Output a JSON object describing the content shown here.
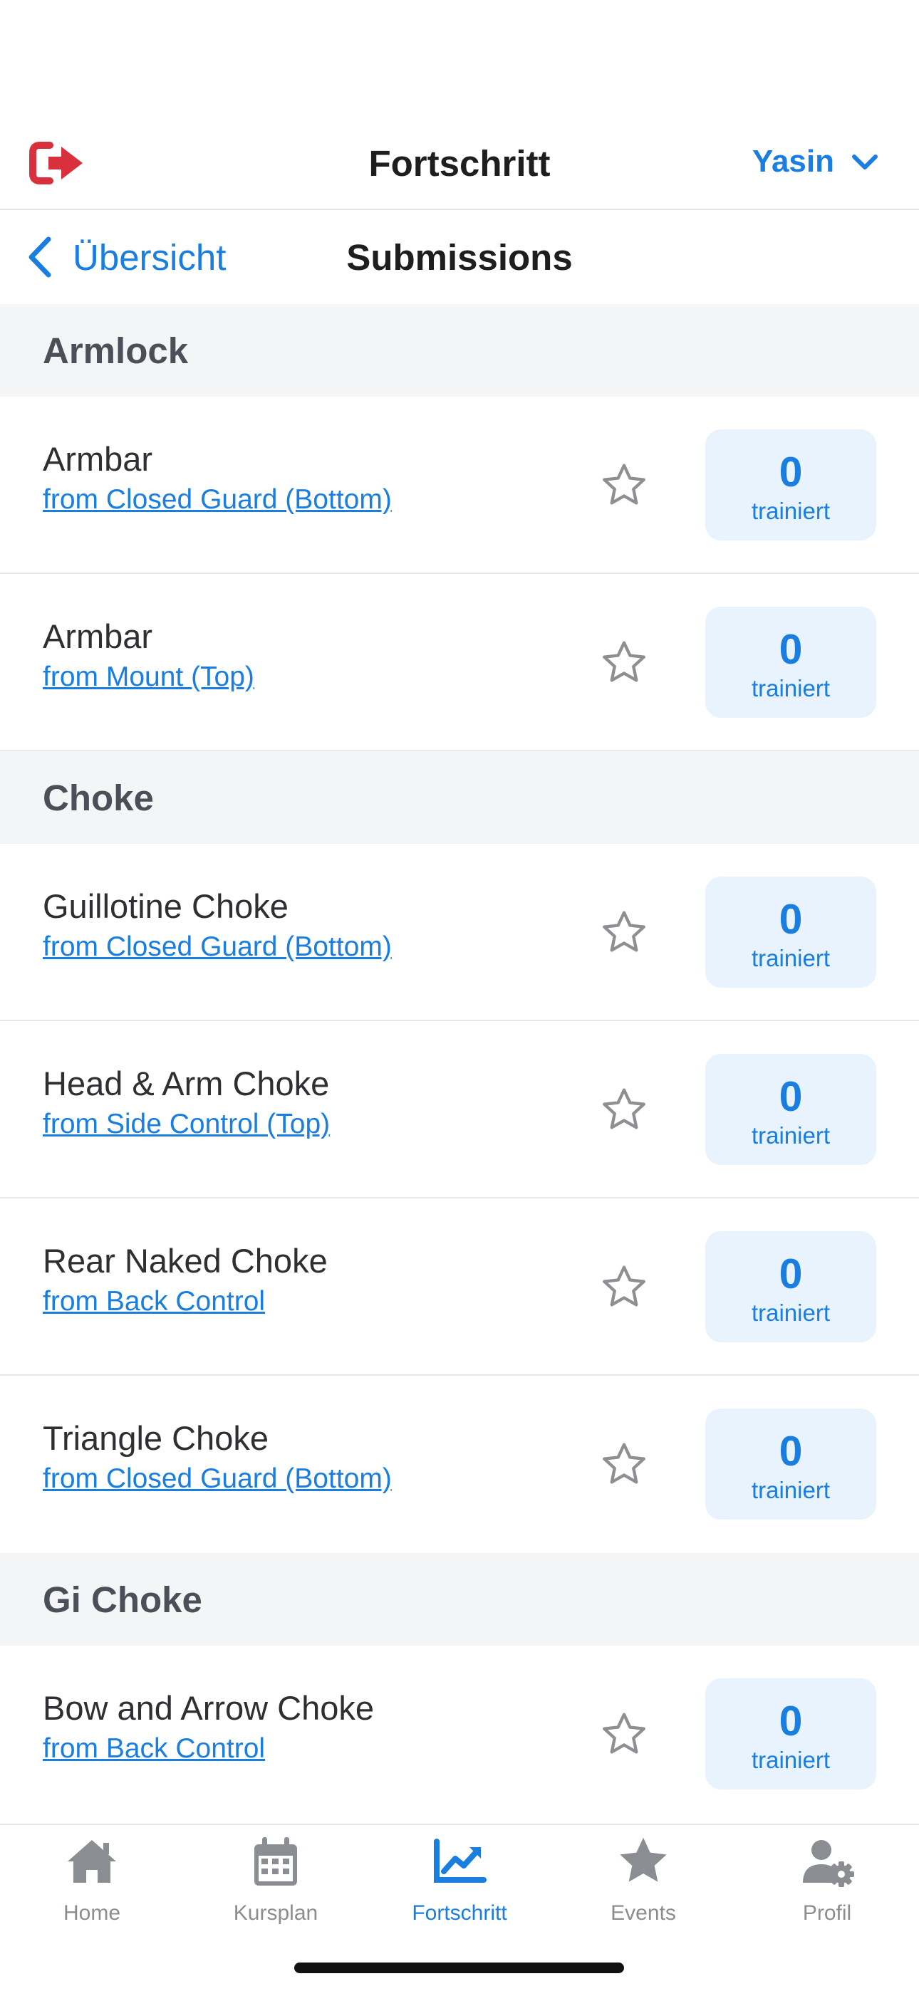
{
  "header": {
    "title": "Fortschritt",
    "user_name": "Yasin",
    "logout_icon": "logout-icon",
    "accent": "#1a7ee0",
    "danger": "#d8303c"
  },
  "subheader": {
    "back_label": "Übersicht",
    "title": "Submissions"
  },
  "sections": [
    {
      "title": "Armlock",
      "items": [
        {
          "name": "Armbar",
          "position": "from Closed Guard (Bottom)",
          "count": "0",
          "count_label": "trainiert"
        },
        {
          "name": "Armbar",
          "position": "from Mount (Top)",
          "count": "0",
          "count_label": "trainiert"
        }
      ]
    },
    {
      "title": "Choke",
      "items": [
        {
          "name": "Guillotine Choke",
          "position": "from Closed Guard (Bottom)",
          "count": "0",
          "count_label": "trainiert"
        },
        {
          "name": "Head & Arm Choke",
          "position": "from Side Control (Top)",
          "count": "0",
          "count_label": "trainiert"
        },
        {
          "name": "Rear Naked Choke",
          "position": "from Back Control",
          "count": "0",
          "count_label": "trainiert"
        },
        {
          "name": "Triangle Choke",
          "position": "from Closed Guard (Bottom)",
          "count": "0",
          "count_label": "trainiert"
        }
      ]
    },
    {
      "title": "Gi Choke",
      "items": [
        {
          "name": "Bow and Arrow Choke",
          "position": "from Back Control",
          "count": "0",
          "count_label": "trainiert"
        }
      ]
    }
  ],
  "tabbar": {
    "items": [
      {
        "label": "Home",
        "icon": "home-icon",
        "active": false
      },
      {
        "label": "Kursplan",
        "icon": "calendar-icon",
        "active": false
      },
      {
        "label": "Fortschritt",
        "icon": "chart-line-icon",
        "active": true
      },
      {
        "label": "Events",
        "icon": "star-icon",
        "active": false
      },
      {
        "label": "Profil",
        "icon": "user-gear-icon",
        "active": false
      }
    ]
  }
}
